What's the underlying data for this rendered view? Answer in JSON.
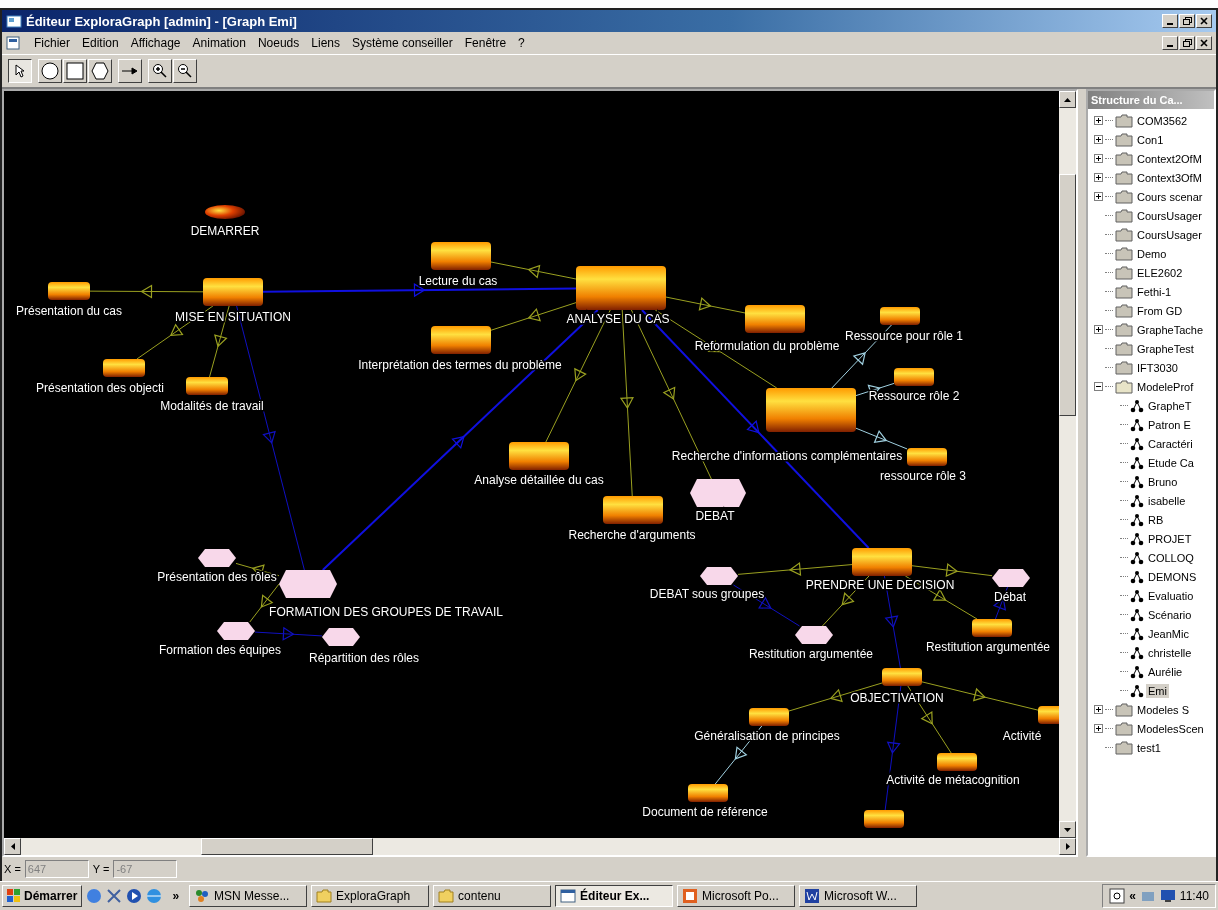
{
  "window": {
    "title": "Éditeur ExploraGraph [admin] - [Graph Emi]"
  },
  "menu": [
    "Fichier",
    "Edition",
    "Affichage",
    "Animation",
    "Noeuds",
    "Liens",
    "Système conseiller",
    "Fenêtre",
    "?"
  ],
  "toolbar": [
    {
      "kind": "pointer",
      "selected": true
    },
    {
      "kind": "circle",
      "selected": false
    },
    {
      "kind": "square",
      "selected": false
    },
    {
      "kind": "hexagon",
      "selected": false
    },
    {
      "kind": "link",
      "selected": false
    },
    {
      "kind": "zoom-in",
      "selected": false
    },
    {
      "kind": "zoom-out",
      "selected": false
    }
  ],
  "graph": {
    "nodes": [
      {
        "label": "DEMARRER",
        "kind": "disc"
      },
      {
        "label": "MISE EN SITUATION",
        "kind": "cylinder"
      },
      {
        "label": "Présentation du cas",
        "kind": "cylinder"
      },
      {
        "label": "Présentation des objecti",
        "kind": "cylinder"
      },
      {
        "label": "Modalités de travail",
        "kind": "cylinder"
      },
      {
        "label": "Lecture du cas",
        "kind": "cylinder"
      },
      {
        "label": "Interprétation des termes du problème",
        "kind": "cylinder"
      },
      {
        "label": "ANALYSE DU CAS",
        "kind": "cylinder"
      },
      {
        "label": "Reformulation du problème",
        "kind": "cylinder"
      },
      {
        "label": "Ressource pour rôle 1",
        "kind": "cylinder"
      },
      {
        "label": "Ressource rôle 2",
        "kind": "cylinder"
      },
      {
        "label": "Recherche d'informations complémentaires",
        "kind": "cylinder"
      },
      {
        "label": "ressource rôle 3",
        "kind": "cylinder"
      },
      {
        "label": "Analyse détaillée du cas",
        "kind": "cylinder"
      },
      {
        "label": "Recherche d'arguments",
        "kind": "cylinder"
      },
      {
        "label": "DEBAT",
        "kind": "hexagon"
      },
      {
        "label": "PRENDRE UNE DECISION",
        "kind": "cylinder"
      },
      {
        "label": "DEBAT sous groupes",
        "kind": "hexagon"
      },
      {
        "label": "Débat",
        "kind": "hexagon"
      },
      {
        "label": "Restitution argumentée",
        "kind": "hexagon"
      },
      {
        "label": "Restitution argumentée",
        "kind": "cylinder"
      },
      {
        "label": "OBJECTIVATION",
        "kind": "cylinder"
      },
      {
        "label": "Généralisation de principes",
        "kind": "cylinder"
      },
      {
        "label": "Activité",
        "kind": "cylinder"
      },
      {
        "label": "Activité de métacognition",
        "kind": "cylinder"
      },
      {
        "label": "Document de référence",
        "kind": "cylinder"
      },
      {
        "kind": "cylinder"
      },
      {
        "label": "FORMATION DES GROUPES DE TRAVAIL",
        "kind": "hexagon"
      },
      {
        "label": "Présentation des rôles",
        "kind": "hexagon"
      },
      {
        "label": "Formation des équipes",
        "kind": "hexagon"
      },
      {
        "label": "Répartition des rôles",
        "kind": "hexagon"
      }
    ]
  },
  "tree": {
    "title": "Structure du Ca...",
    "items": [
      {
        "label": "COM3562",
        "kind": "collapsed",
        "selected": false
      },
      {
        "label": "Con1",
        "kind": "collapsed",
        "selected": false
      },
      {
        "label": "Context2OfM",
        "kind": "collapsed",
        "selected": false
      },
      {
        "label": "Context3OfM",
        "kind": "collapsed",
        "selected": false
      },
      {
        "label": "Cours scenar",
        "kind": "collapsed",
        "selected": false
      },
      {
        "label": "CoursUsager",
        "kind": "leaf",
        "selected": false
      },
      {
        "label": "CoursUsager",
        "kind": "leaf",
        "selected": false
      },
      {
        "label": "Demo",
        "kind": "leaf",
        "selected": false
      },
      {
        "label": "ELE2602",
        "kind": "leaf",
        "selected": false
      },
      {
        "label": "Fethi-1",
        "kind": "leaf",
        "selected": false
      },
      {
        "label": "From GD",
        "kind": "leaf",
        "selected": false
      },
      {
        "label": "GrapheTache",
        "kind": "collapsed",
        "selected": false
      },
      {
        "label": "GrapheTest",
        "kind": "leaf",
        "selected": false
      },
      {
        "label": "IFT3030",
        "kind": "leaf",
        "selected": false
      },
      {
        "label": "ModeleProf",
        "kind": "expanded",
        "selected": false,
        "children": [
          {
            "label": "GrapheT",
            "kind": "graph",
            "selected": false
          },
          {
            "label": "Patron E",
            "kind": "graph",
            "selected": false
          },
          {
            "label": "Caractéri",
            "kind": "graph",
            "selected": false
          },
          {
            "label": "Etude Ca",
            "kind": "graph",
            "selected": false
          },
          {
            "label": "Bruno",
            "kind": "graph",
            "selected": false
          },
          {
            "label": "isabelle",
            "kind": "graph",
            "selected": false
          },
          {
            "label": "RB",
            "kind": "graph",
            "selected": false
          },
          {
            "label": "PROJET",
            "kind": "graph",
            "selected": false
          },
          {
            "label": "COLLOQ",
            "kind": "graph",
            "selected": false
          },
          {
            "label": "DEMONS",
            "kind": "graph",
            "selected": false
          },
          {
            "label": "Evaluatio",
            "kind": "graph",
            "selected": false
          },
          {
            "label": "Scénario",
            "kind": "graph",
            "selected": false
          },
          {
            "label": "JeanMic",
            "kind": "graph",
            "selected": false
          },
          {
            "label": "christelle",
            "kind": "graph",
            "selected": false
          },
          {
            "label": "Aurélie",
            "kind": "graph",
            "selected": false
          },
          {
            "label": "Emi",
            "kind": "graph",
            "selected": true
          }
        ]
      },
      {
        "label": "Modeles S",
        "kind": "collapsed",
        "selected": false
      },
      {
        "label": "ModelesScen",
        "kind": "collapsed",
        "selected": false
      },
      {
        "label": "test1",
        "kind": "leaf",
        "selected": false
      }
    ]
  },
  "status_bar": {
    "x_label": "X =",
    "x_value": "647",
    "y_label": "Y =",
    "y_value": "-67"
  },
  "taskbar": {
    "start": "Démarrer",
    "more": "»",
    "tasks": [
      {
        "label": "MSN Messe...",
        "kind": "msn",
        "selected": false
      },
      {
        "label": "ExploraGraph",
        "kind": "folder",
        "selected": false
      },
      {
        "label": "contenu",
        "kind": "folder",
        "selected": false
      },
      {
        "label": "Éditeur Ex...",
        "kind": "app",
        "selected": true
      },
      {
        "label": "Microsoft Po...",
        "kind": "powerpoint",
        "selected": false
      },
      {
        "label": "Microsoft W...",
        "kind": "word",
        "selected": false
      }
    ],
    "tray_more": "«",
    "clock": "11:40"
  }
}
